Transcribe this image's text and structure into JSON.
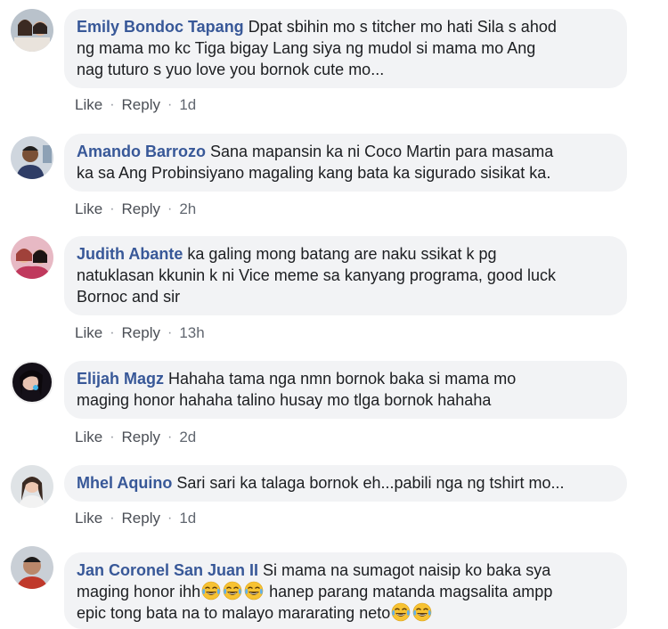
{
  "comments": [
    {
      "author": "Emily Bondoc Tapang",
      "lines": [
        "Dpat sbihin mo s titcher mo hati Sila s ahod",
        "ng mama mo kc Tiga bigay Lang siya ng mudol si mama mo Ang",
        "nag tuturo s yuo love you bornok cute mo..."
      ],
      "like": "Like",
      "reply": "Reply",
      "time": "1d"
    },
    {
      "author": "Amando Barrozo",
      "lines": [
        "Sana mapansin ka ni Coco Martin para masama",
        "ka sa Ang Probinsiyano magaling kang bata ka sigurado sisikat ka."
      ],
      "like": "Like",
      "reply": "Reply",
      "time": "2h"
    },
    {
      "author": "Judith Abante",
      "lines": [
        "ka galing mong batang are naku ssikat k pg",
        "natuklasan kkunin k ni Vice meme sa kanyang programa, good luck",
        "Bornoc and sir"
      ],
      "like": "Like",
      "reply": "Reply",
      "time": "13h"
    },
    {
      "author": "Elijah Magz",
      "lines": [
        "Hahaha tama nga nmn bornok baka si mama mo",
        "maging honor hahaha talino husay mo tlga bornok hahaha"
      ],
      "like": "Like",
      "reply": "Reply",
      "time": "2d"
    },
    {
      "author": "Mhel Aquino",
      "lines": [
        "Sari sari ka talaga bornok eh...pabili nga ng tshirt mo..."
      ],
      "like": "Like",
      "reply": "Reply",
      "time": "1d"
    },
    {
      "author": "Jan Coronel San Juan II",
      "line1": "Si mama na sumagot naisip ko baka sya",
      "line2_pre": "maging honor ihh",
      "line2_post": " hanep parang matanda magsalita ampp",
      "line3": "epic tong bata na to malayo mararating neto",
      "emoji": "face-with-tears-of-joy-icon"
    }
  ],
  "colors": {
    "author": "#385898",
    "bubble": "#f2f3f5",
    "action": "#4b4f56"
  }
}
